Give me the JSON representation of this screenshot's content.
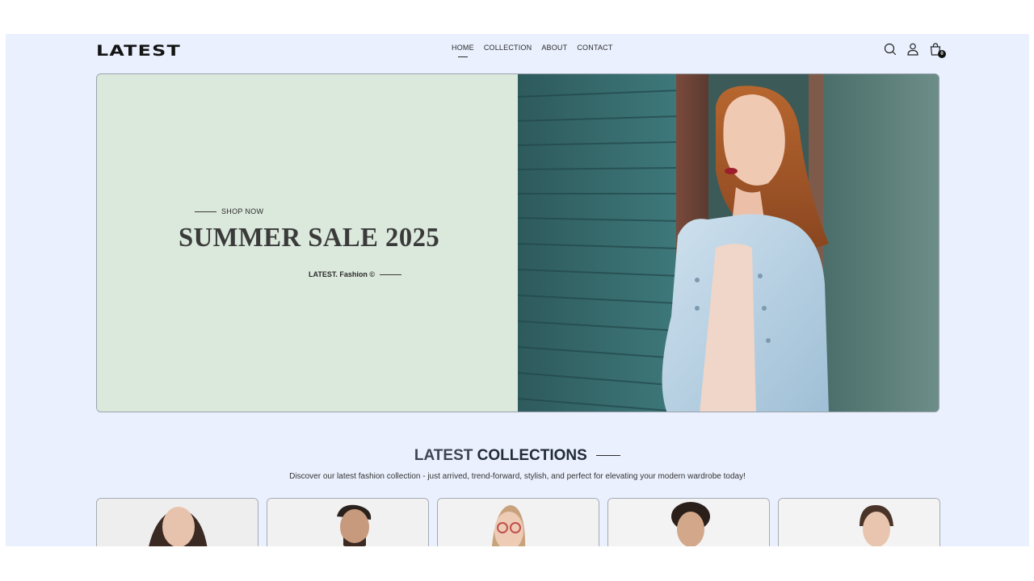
{
  "brand": {
    "logo_text": "LATEST"
  },
  "nav": {
    "links": [
      {
        "label": "HOME",
        "active": true
      },
      {
        "label": "COLLECTION",
        "active": false
      },
      {
        "label": "ABOUT",
        "active": false
      },
      {
        "label": "CONTACT",
        "active": false
      }
    ],
    "icons": [
      "search-icon",
      "user-icon",
      "shopping-bag-icon"
    ],
    "cart_count": "0"
  },
  "hero": {
    "cta_label": "SHOP NOW",
    "title": "SUMMER SALE 2025",
    "tagline": "LATEST. Fashion ©",
    "bg_color": "#dbe8dc"
  },
  "collections": {
    "heading_light": "LATEST",
    "heading_bold": "COLLECTIONS",
    "description": "Discover our latest fashion collection - just arrived, trend-forward, stylish, and perfect for elevating your modern wardrobe today!",
    "product_card_count": 5
  },
  "colors": {
    "page_bg": "#eaf0fd",
    "text_dark": "#222b38"
  }
}
